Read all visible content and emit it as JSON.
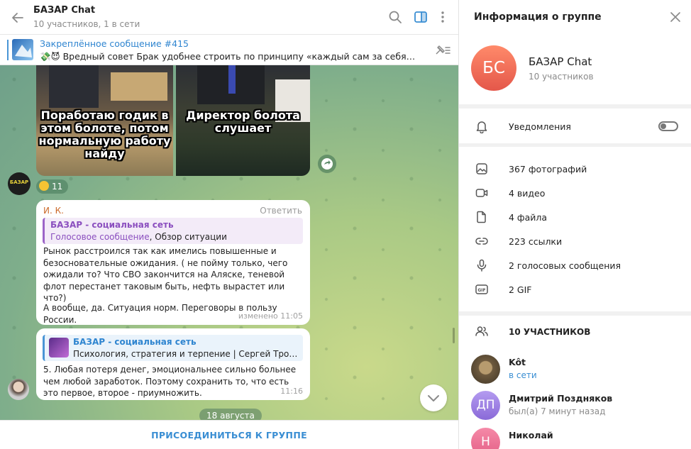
{
  "chat": {
    "title": "БАЗАР Chat",
    "subtitle": "10 участников, 1 в сети",
    "pinned": {
      "title": "Закреплённое сообщение #415",
      "text": "💸😈 Вредный совет Брак удобнее строить по принципу «каждый сам за себя». Чтобы у каж..."
    },
    "photos": [
      {
        "caption": "Поработаю годик в этом болоте, потом нормальную работу найду"
      },
      {
        "caption": "Директор болота слушает"
      }
    ],
    "bazar_avatar_text": "БАЗАР",
    "reaction": {
      "count": "11"
    },
    "messages": [
      {
        "author": "И. К.",
        "reply_label": "Ответить",
        "quote_name": "БАЗАР - социальная сеть",
        "quote_voice": "Голосовое сообщение",
        "quote_rest": ", Обзор ситуации",
        "text1": "Рынок расстроился так как имелись повышенные и безосновательные ожидания. ( не пойму только, чего ожидали то? Что СВО закончится на Аляске, теневой флот перестанет таковым быть, нефть вырастет или что?)",
        "text2": "А вообще, да. Ситуация норм. Переговоры в пользу России.",
        "time": "изменено 11:05"
      },
      {
        "quote_name": "БАЗАР - социальная сеть",
        "quote_line": "Психология, стратегия и терпение | Сергей Трофимов ...",
        "text": "5. Любая потеря денег, эмоциональнее сильно больнее чем любой заработок. Поэтому сохранить то, что есть это первое, второе - приумножить.",
        "time": "11:16"
      }
    ],
    "date_pill": "18 августа",
    "join_label": "ПРИСОЕДИНИТЬСЯ К ГРУППЕ"
  },
  "info": {
    "title": "Информация о группе",
    "avatar_initials": "БС",
    "group_name": "БАЗАР Chat",
    "group_sub": "10 участников",
    "notifications_label": "Уведомления",
    "media": [
      {
        "icon": "photo-icon",
        "label": "367 фотографий"
      },
      {
        "icon": "video-icon",
        "label": "4 видео"
      },
      {
        "icon": "file-icon",
        "label": "4 файла"
      },
      {
        "icon": "link-icon",
        "label": "223 ссылки"
      },
      {
        "icon": "mic-icon",
        "label": "2 голосовых сообщения"
      },
      {
        "icon": "gif-icon",
        "label": "2 GIF"
      }
    ],
    "members_header": "10 УЧАСТНИКОВ",
    "members": [
      {
        "name": "Kôt",
        "status": "в сети",
        "initials": "",
        "color": "#7a6a4f"
      },
      {
        "name": "Дмитрий Поздняков",
        "status": "был(а) 7 минут назад",
        "initials": "ДП",
        "color": "#9b7fe0"
      },
      {
        "name": "Николай",
        "status": "",
        "initials": "Н",
        "color": "#ea6a8e"
      }
    ]
  }
}
